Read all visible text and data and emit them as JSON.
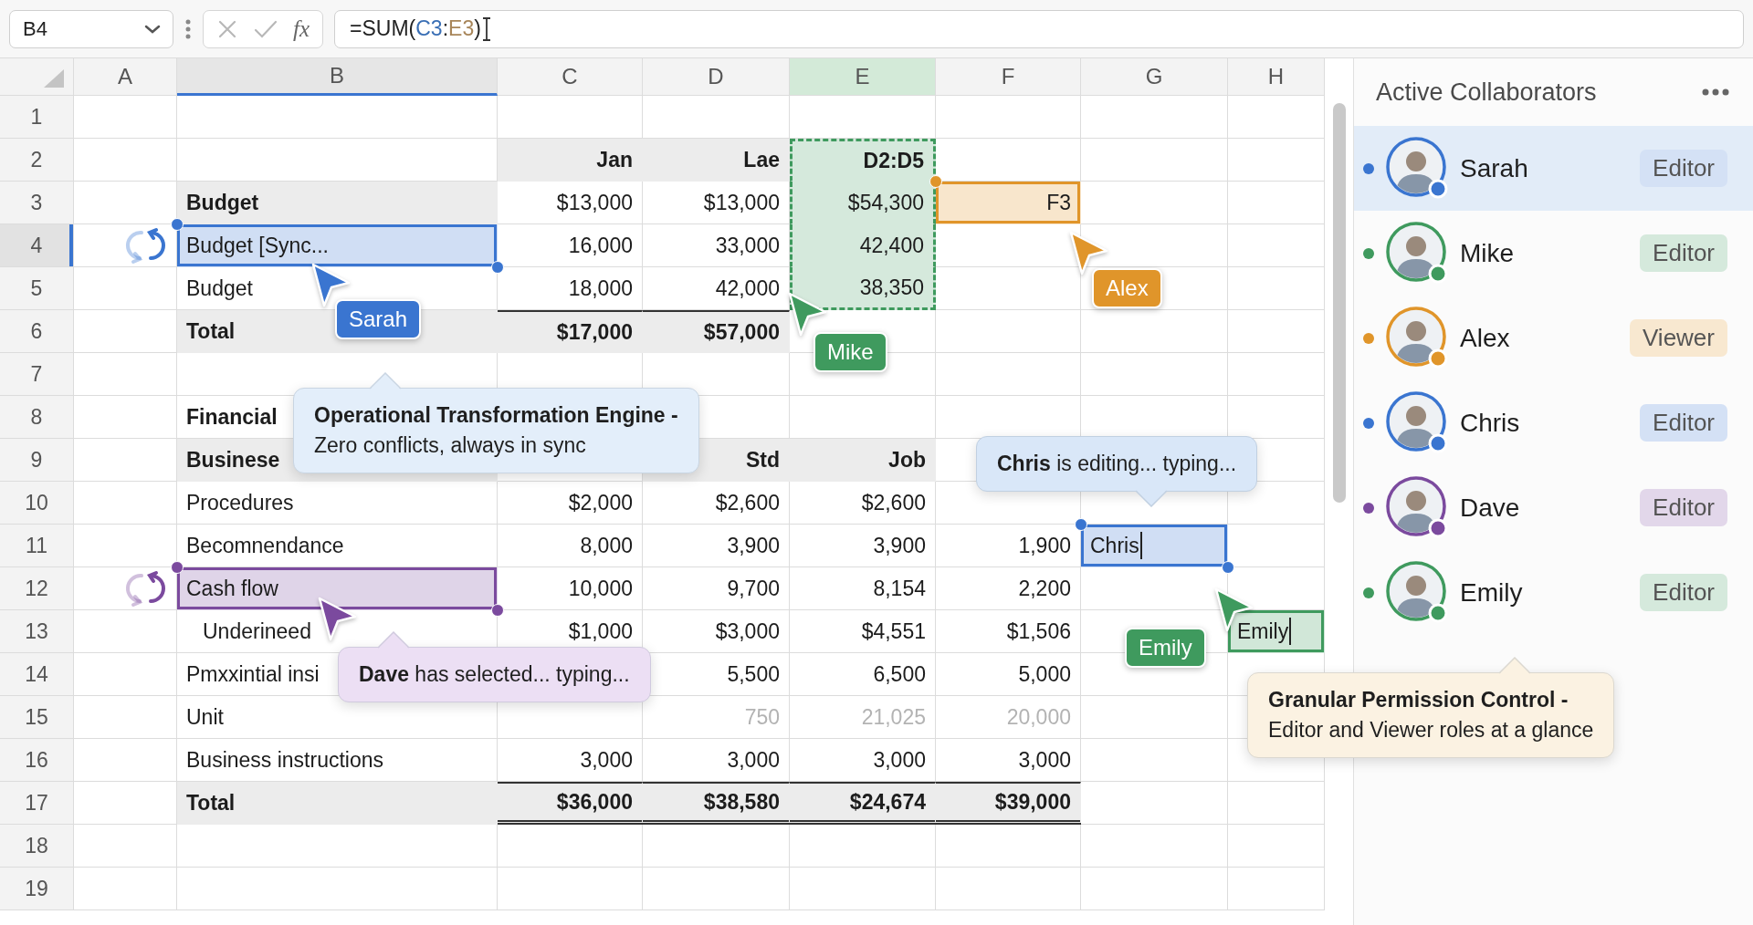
{
  "formula_bar": {
    "name_box": "B4",
    "function_label": "fx",
    "formula": "=SUM(C3:E3)"
  },
  "sheet": {
    "columns": [
      {
        "label": "A",
        "selected": false,
        "in_range": false
      },
      {
        "label": "B",
        "selected": true,
        "in_range": false
      },
      {
        "label": "C",
        "selected": false,
        "in_range": false
      },
      {
        "label": "D",
        "selected": false,
        "in_range": false
      },
      {
        "label": "E",
        "selected": false,
        "in_range": true
      },
      {
        "label": "F",
        "selected": false,
        "in_range": false
      },
      {
        "label": "G",
        "selected": false,
        "in_range": false
      },
      {
        "label": "H",
        "selected": false,
        "in_range": false
      }
    ],
    "rows": [
      {
        "label": "1",
        "selected": false
      },
      {
        "label": "2",
        "selected": false,
        "cells": {
          "c": {
            "text": "Jan",
            "bold": true,
            "shaded": true,
            "faded": false
          },
          "d": {
            "text": "Lae",
            "bold": true,
            "shaded": true,
            "faded": false
          },
          "e": {
            "text": "D2:D5",
            "bold": true,
            "faded": false,
            "selection": {
              "kind": "range",
              "color": "#3f9a5e",
              "start_handle": false,
              "end_handle": false
            }
          }
        }
      },
      {
        "label": "3",
        "selected": false,
        "cells": {
          "b": {
            "text": "Budget",
            "bold": true,
            "shaded": true,
            "faded": false
          },
          "c": {
            "text": "$13,000",
            "bold": false,
            "shaded": false,
            "faded": false
          },
          "d": {
            "text": "$13,000",
            "bold": false,
            "shaded": false,
            "faded": false
          },
          "e": {
            "text": "$54,300",
            "bold": false,
            "faded": false,
            "selection": {
              "kind": "range",
              "color": "#3f9a5e",
              "start_handle": false,
              "end_handle": false
            }
          },
          "f": {
            "text": "F3",
            "bold": false,
            "faded": false,
            "selection": {
              "kind": "cursor",
              "color": "#e0952a",
              "start_handle": true,
              "end_handle": false
            }
          }
        }
      },
      {
        "label": "4",
        "selected": true,
        "cells": {
          "a": {
            "syncing": true,
            "color": "#3a75d0"
          },
          "b": {
            "text": "Budget [Sync...",
            "bold": false,
            "faded": false,
            "selection": {
              "kind": "cursor",
              "color": "#3a75d0",
              "start_handle": true,
              "end_handle": true
            }
          },
          "c": {
            "text": "16,000",
            "bold": false,
            "shaded": false,
            "faded": false
          },
          "d": {
            "text": "33,000",
            "bold": false,
            "shaded": false,
            "faded": false
          },
          "e": {
            "text": "42,400",
            "bold": false,
            "faded": false,
            "selection": {
              "kind": "range",
              "color": "#3f9a5e",
              "start_handle": false,
              "end_handle": false
            }
          }
        }
      },
      {
        "label": "5",
        "selected": false,
        "cells": {
          "b": {
            "text": "Budget",
            "bold": false,
            "shaded": false,
            "faded": false
          },
          "c": {
            "text": "18,000",
            "bold": false,
            "shaded": false,
            "faded": false
          },
          "d": {
            "text": "42,000",
            "bold": false,
            "shaded": false,
            "faded": false
          },
          "e": {
            "text": "38,350",
            "bold": false,
            "faded": false,
            "selection": {
              "kind": "range",
              "color": "#3f9a5e",
              "start_handle": false,
              "end_handle": false
            }
          }
        }
      },
      {
        "label": "6",
        "selected": false,
        "cells": {
          "b": {
            "text": "Total",
            "bold": true,
            "shaded": true,
            "faded": false
          },
          "c": {
            "text": "$17,000",
            "bold": true,
            "shaded": true,
            "faded": false,
            "rule_above": true
          },
          "d": {
            "text": "$57,000",
            "bold": true,
            "shaded": true,
            "faded": false,
            "rule_above": true
          }
        }
      },
      {
        "label": "7",
        "selected": false
      },
      {
        "label": "8",
        "selected": false,
        "cells": {
          "b": {
            "text": "Financial",
            "bold": true,
            "shaded": false,
            "faded": false
          }
        }
      },
      {
        "label": "9",
        "selected": false,
        "cells": {
          "b": {
            "text": "Businese",
            "bold": true,
            "shaded": true,
            "faded": false
          },
          "d": {
            "text": "Std",
            "bold": true,
            "shaded": true,
            "faded": false
          },
          "e": {
            "text": "Job",
            "bold": true,
            "shaded": true,
            "faded": false
          }
        }
      },
      {
        "label": "10",
        "selected": false,
        "cells": {
          "b": {
            "text": "Procedures",
            "bold": false,
            "shaded": false,
            "faded": false
          },
          "c": {
            "text": "$2,000",
            "bold": false,
            "shaded": false,
            "faded": false
          },
          "d": {
            "text": "$2,600",
            "bold": false,
            "shaded": false,
            "faded": false
          },
          "e": {
            "text": "$2,600",
            "bold": false,
            "shaded": false,
            "faded": false
          }
        }
      },
      {
        "label": "11",
        "selected": false,
        "cells": {
          "b": {
            "text": "Becomnendance",
            "bold": false,
            "shaded": false,
            "faded": false
          },
          "c": {
            "text": "8,000",
            "bold": false,
            "shaded": false,
            "faded": false
          },
          "d": {
            "text": "3,900",
            "bold": false,
            "shaded": false,
            "faded": false
          },
          "e": {
            "text": "3,900",
            "bold": false,
            "shaded": false,
            "faded": false
          },
          "f": {
            "text": "1,900",
            "bold": false,
            "shaded": false,
            "faded": false
          },
          "g": {
            "text": "Chris",
            "bold": false,
            "faded": false,
            "editing": true,
            "selection": {
              "kind": "cursor",
              "color": "#3a75d0",
              "start_handle": true,
              "end_handle": true
            }
          }
        }
      },
      {
        "label": "12",
        "selected": false,
        "cells": {
          "a": {
            "syncing": true,
            "color": "#7b4a9e"
          },
          "b": {
            "text": "Cash flow",
            "bold": false,
            "faded": false,
            "selection": {
              "kind": "cursor",
              "color": "#7b4a9e",
              "start_handle": true,
              "end_handle": true
            }
          },
          "c": {
            "text": "10,000",
            "bold": false,
            "shaded": false,
            "faded": false
          },
          "d": {
            "text": "9,700",
            "bold": false,
            "shaded": false,
            "faded": false
          },
          "e": {
            "text": "8,154",
            "bold": false,
            "shaded": false,
            "faded": false
          },
          "f": {
            "text": "2,200",
            "bold": false,
            "shaded": false,
            "faded": false
          }
        }
      },
      {
        "label": "13",
        "selected": false,
        "cells": {
          "b": {
            "text": "Underineed",
            "bold": false,
            "shaded": false,
            "faded": false,
            "indented": true
          },
          "c": {
            "text": "$1,000",
            "bold": false,
            "shaded": false,
            "faded": false
          },
          "d": {
            "text": "$3,000",
            "bold": false,
            "shaded": false,
            "faded": false
          },
          "e": {
            "text": "$4,551",
            "bold": false,
            "shaded": false,
            "faded": false
          },
          "f": {
            "text": "$1,506",
            "bold": false,
            "shaded": false,
            "faded": false
          },
          "h": {
            "text": "Emily",
            "bold": false,
            "faded": false,
            "editing": true,
            "selection": {
              "kind": "cursor",
              "color": "#3f9a5e",
              "start_handle": false,
              "end_handle": false
            }
          }
        }
      },
      {
        "label": "14",
        "selected": false,
        "cells": {
          "b": {
            "text": "Pmxxintial insi",
            "bold": false,
            "shaded": false,
            "faded": false
          },
          "d": {
            "text": "5,500",
            "bold": false,
            "shaded": false,
            "faded": false
          },
          "e": {
            "text": "6,500",
            "bold": false,
            "shaded": false,
            "faded": false
          },
          "f": {
            "text": "5,000",
            "bold": false,
            "shaded": false,
            "faded": false
          }
        }
      },
      {
        "label": "15",
        "selected": false,
        "cells": {
          "b": {
            "text": "Unit",
            "bold": false,
            "shaded": false,
            "faded": false
          },
          "d": {
            "text": "750",
            "bold": false,
            "shaded": false,
            "faded": true
          },
          "e": {
            "text": "21,025",
            "bold": false,
            "shaded": false,
            "faded": true
          },
          "f": {
            "text": "20,000",
            "bold": false,
            "shaded": false,
            "faded": true
          }
        }
      },
      {
        "label": "16",
        "selected": false,
        "cells": {
          "b": {
            "text": "Business instructions",
            "bold": false,
            "shaded": false,
            "faded": false
          },
          "c": {
            "text": "3,000",
            "bold": false,
            "shaded": false,
            "faded": false
          },
          "d": {
            "text": "3,000",
            "bold": false,
            "shaded": false,
            "faded": false
          },
          "e": {
            "text": "3,000",
            "bold": false,
            "shaded": false,
            "faded": false
          },
          "f": {
            "text": "3,000",
            "bold": false,
            "shaded": false,
            "faded": false
          }
        }
      },
      {
        "label": "17",
        "selected": false,
        "cells": {
          "b": {
            "text": "Total",
            "bold": true,
            "shaded": true,
            "faded": false
          },
          "c": {
            "text": "$36,000",
            "bold": true,
            "shaded": true,
            "faded": false,
            "rule_above": true,
            "double_rule_below": true
          },
          "d": {
            "text": "$38,580",
            "bold": true,
            "shaded": true,
            "faded": false,
            "rule_above": true,
            "double_rule_below": true
          },
          "e": {
            "text": "$24,674",
            "bold": true,
            "shaded": true,
            "faded": false,
            "rule_above": true,
            "double_rule_below": true
          },
          "f": {
            "text": "$39,000",
            "bold": true,
            "shaded": true,
            "faded": false,
            "rule_above": true,
            "double_rule_below": true
          }
        }
      },
      {
        "label": "18",
        "selected": false
      },
      {
        "label": "19",
        "selected": false
      }
    ]
  },
  "cursors": [
    {
      "label": "Sarah",
      "color": "#3a75d0"
    },
    {
      "label": "Mike",
      "color": "#3f9a5e"
    },
    {
      "label": "Alex",
      "color": "#e0952a"
    },
    {
      "color": "#7b4a9e"
    },
    {
      "label": "Emily",
      "color": "#3f9a5e"
    }
  ],
  "callouts": [
    {
      "kind": "feature",
      "color": "#e3eefa",
      "title": "Operational Transformation Engine -",
      "text": "Zero conflicts, always in sync"
    },
    {
      "kind": "status",
      "color": "#ecdff4",
      "text": "**Dave** has selected... typing..."
    },
    {
      "kind": "status",
      "color": "#d9e7f8",
      "text": "**Chris** is editing... typing..."
    },
    {
      "kind": "feature",
      "color": "#fbf2e2",
      "title": "Granular Permission Control -",
      "text": "Editor and Viewer roles at a glance"
    }
  ],
  "panel": {
    "title": "Active Collaborators",
    "collaborators": [
      {
        "name": "Sarah",
        "role": "Editor",
        "color": "#3a75d0",
        "selected": true
      },
      {
        "name": "Mike",
        "role": "Editor",
        "color": "#3f9a5e",
        "selected": false
      },
      {
        "name": "Alex",
        "role": "Viewer",
        "color": "#e0952a",
        "selected": false
      },
      {
        "name": "Chris",
        "role": "Editor",
        "color": "#3a75d0",
        "selected": false
      },
      {
        "name": "Dave",
        "role": "Editor",
        "color": "#7b4a9e",
        "selected": false
      },
      {
        "name": "Emily",
        "role": "Editor",
        "color": "#3f9a5e",
        "selected": false
      }
    ]
  }
}
